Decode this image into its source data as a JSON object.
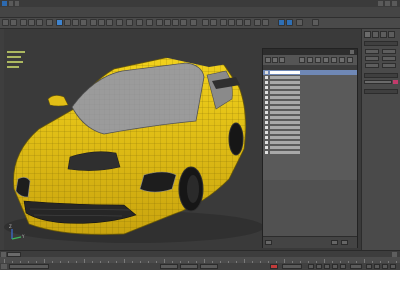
{
  "app": {
    "title": "",
    "menu": [
      "",
      "",
      "",
      "",
      "",
      "",
      "",
      "",
      "",
      "",
      "",
      "",
      ""
    ]
  },
  "viewport": {
    "label": "",
    "gizmo_axes": {
      "z": "Z",
      "y": "Y"
    },
    "car_color": "#e6c417",
    "background": "#3a3a3a"
  },
  "layer_explorer": {
    "title": "",
    "tabs": [
      "",
      "",
      ""
    ],
    "rows": [
      "",
      "",
      "",
      "",
      "",
      "",
      "",
      "",
      "",
      "",
      "",
      "",
      "",
      "",
      "",
      "",
      ""
    ]
  },
  "command_panel": {
    "buttons": [
      "",
      "",
      "",
      "",
      "",
      ""
    ],
    "accent": "#c23b6b"
  },
  "statusbar": {
    "frame_counter": "",
    "hint": ""
  },
  "colors": {
    "ui_dark": "#3b3b3b",
    "selection": "#6f88b6",
    "toolbar_active": "#3f84cf"
  }
}
